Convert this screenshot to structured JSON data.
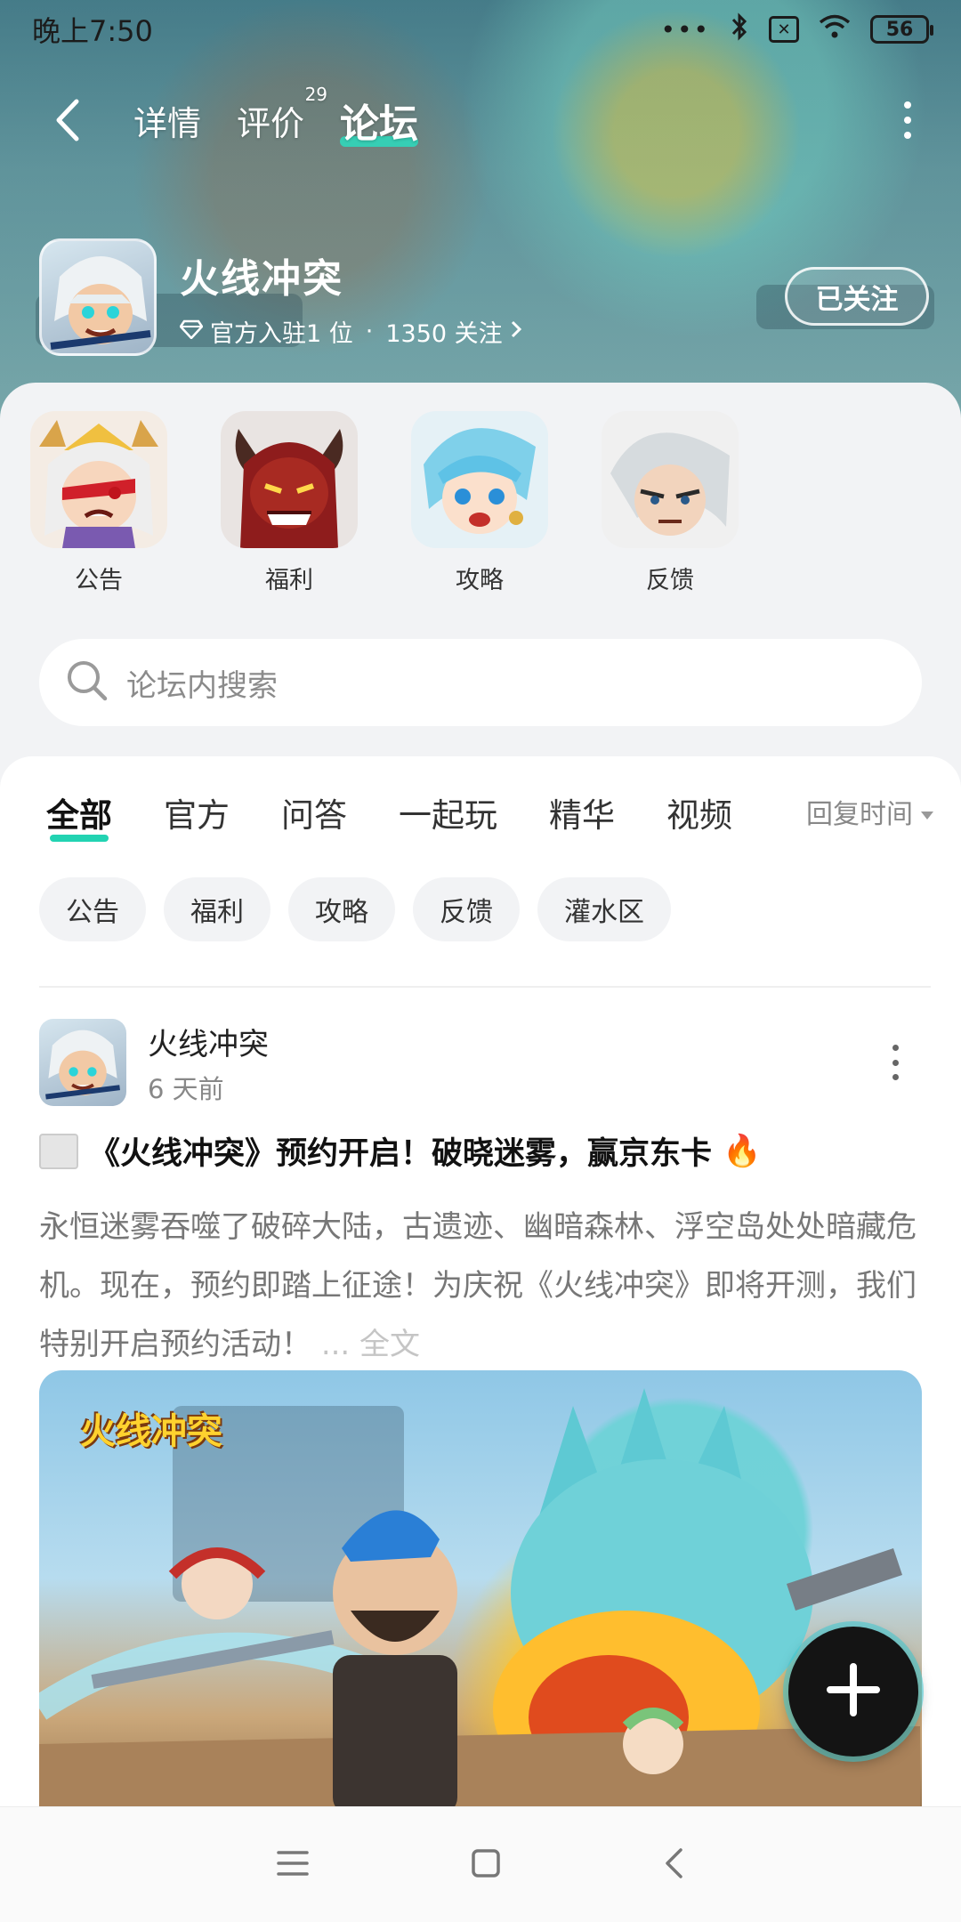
{
  "status_bar": {
    "time": "晚上7:50",
    "battery": "56"
  },
  "top_nav": {
    "tabs": [
      {
        "label": "详情"
      },
      {
        "label": "评价",
        "badge": "29"
      },
      {
        "label": "论坛"
      }
    ],
    "active_tab": "论坛"
  },
  "game": {
    "title": "火线冲突",
    "official": "官方入驻1 位",
    "separator": "·",
    "followers": "1350 关注",
    "follow_button": "已关注"
  },
  "categories": [
    {
      "label": "公告"
    },
    {
      "label": "福利"
    },
    {
      "label": "攻略"
    },
    {
      "label": "反馈"
    }
  ],
  "search": {
    "placeholder": "论坛内搜索"
  },
  "feed_tabs": [
    {
      "label": "全部"
    },
    {
      "label": "官方"
    },
    {
      "label": "问答"
    },
    {
      "label": "一起玩"
    },
    {
      "label": "精华"
    },
    {
      "label": "视频"
    }
  ],
  "sort_label": "回复时间",
  "chips": [
    {
      "label": "公告"
    },
    {
      "label": "福利"
    },
    {
      "label": "攻略"
    },
    {
      "label": "反馈"
    },
    {
      "label": "灌水区"
    }
  ],
  "post": {
    "author": "火线冲突",
    "time": "6 天前",
    "title": "《火线冲突》预约开启！破晓迷雾，赢京东卡",
    "title_emoji": "🔥",
    "body": "永恒迷雾吞噬了破碎大陆，古遗迹、幽暗森林、浮空岛处处暗藏危机。现在，预约即踏上征途！为庆祝《火线冲突》即将开测，我们特别开启预约活动！",
    "more": "... 全文",
    "image_logo": "火线冲突"
  },
  "colors": {
    "accent": "#22d3b2",
    "banner": "#6ca3aa"
  }
}
